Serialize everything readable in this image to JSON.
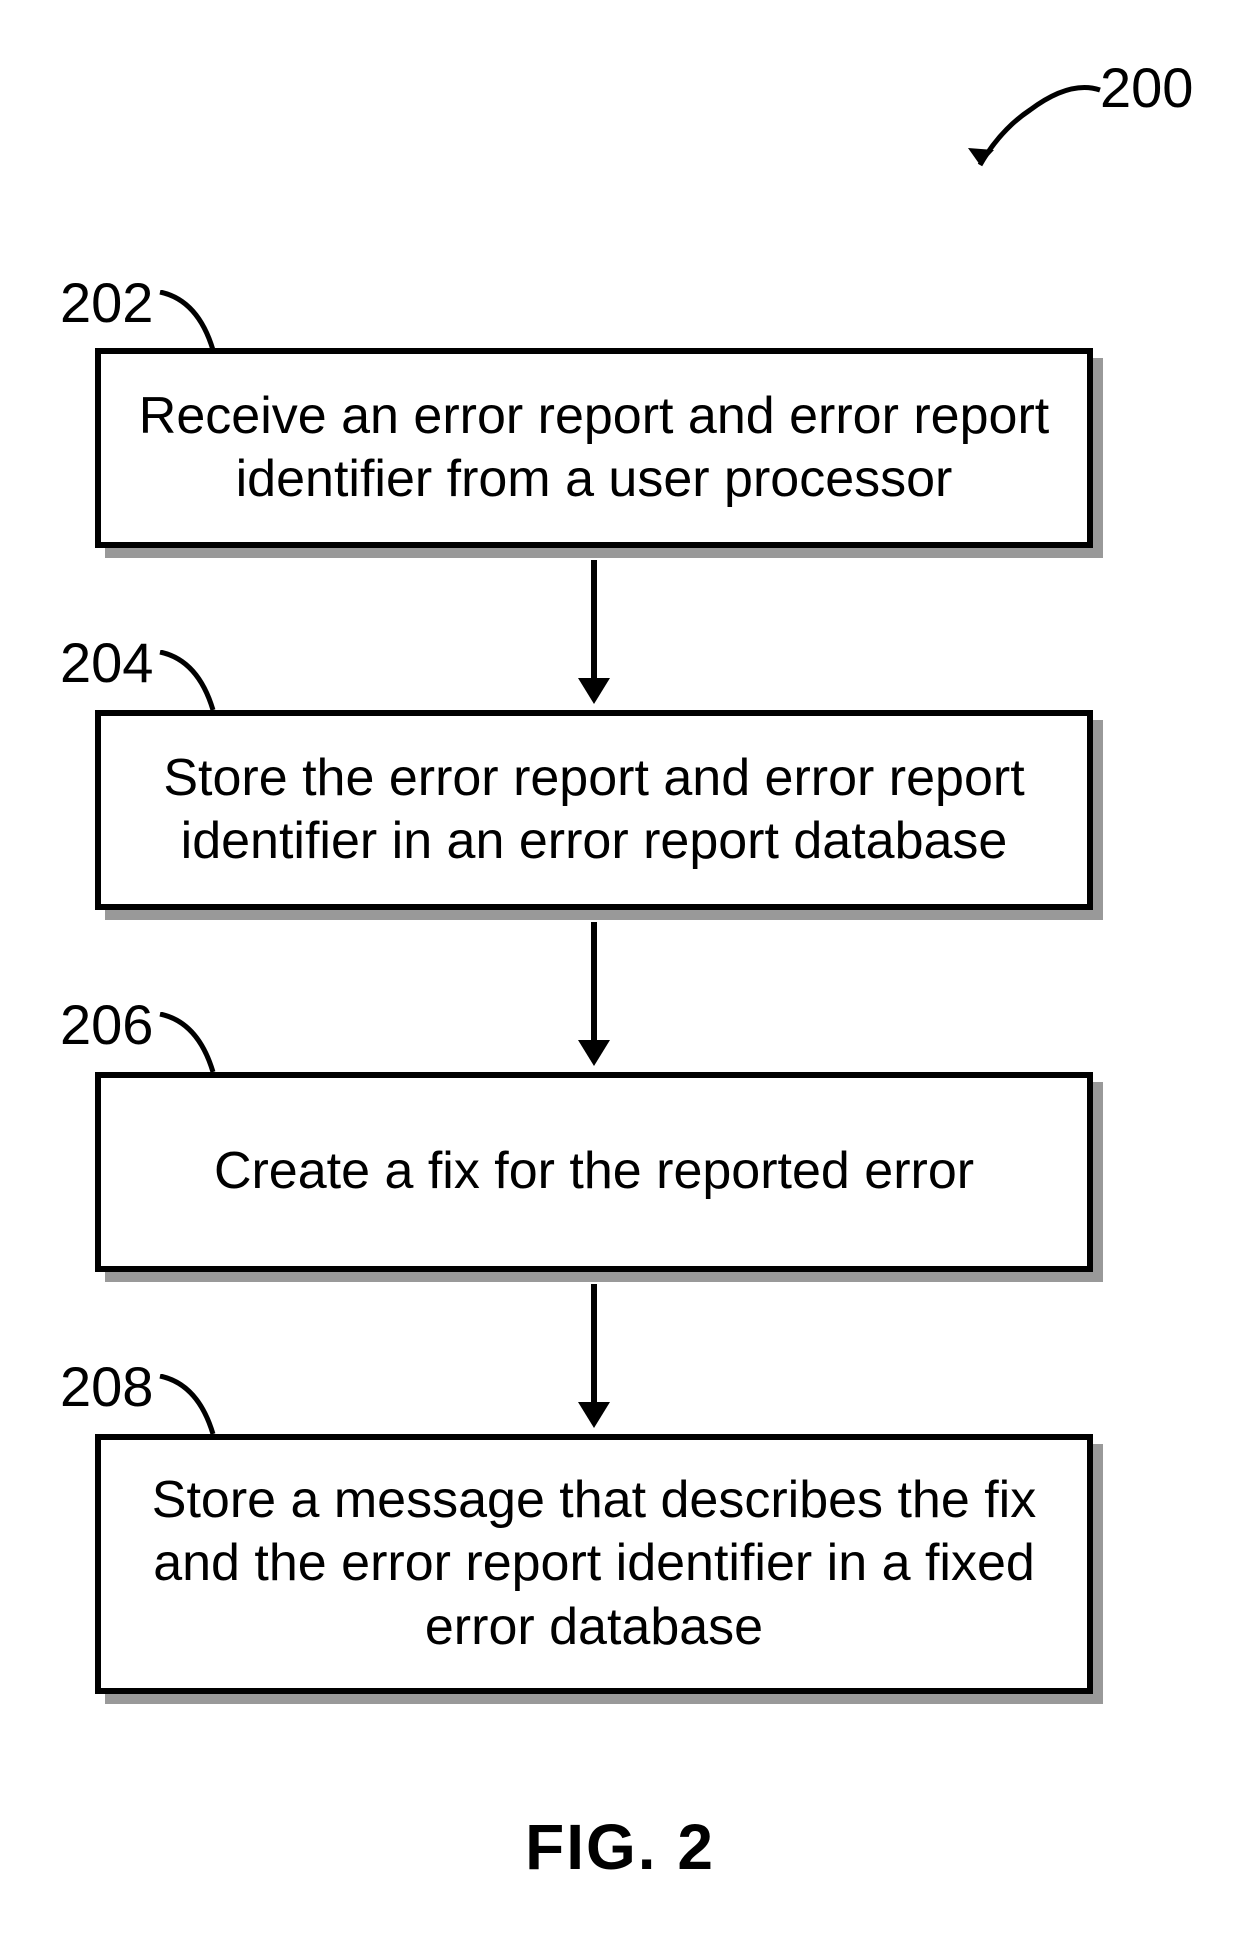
{
  "figure": {
    "label": "FIG. 2",
    "ref": "200"
  },
  "steps": [
    {
      "ref": "202",
      "text": "Receive an error report and error report identifier from a user processor"
    },
    {
      "ref": "204",
      "text": "Store the error report and error report identifier in an error report database"
    },
    {
      "ref": "206",
      "text": "Create a fix for the reported error"
    },
    {
      "ref": "208",
      "text": "Store a message that describes the fix and the error report identifier in a fixed error database"
    }
  ]
}
